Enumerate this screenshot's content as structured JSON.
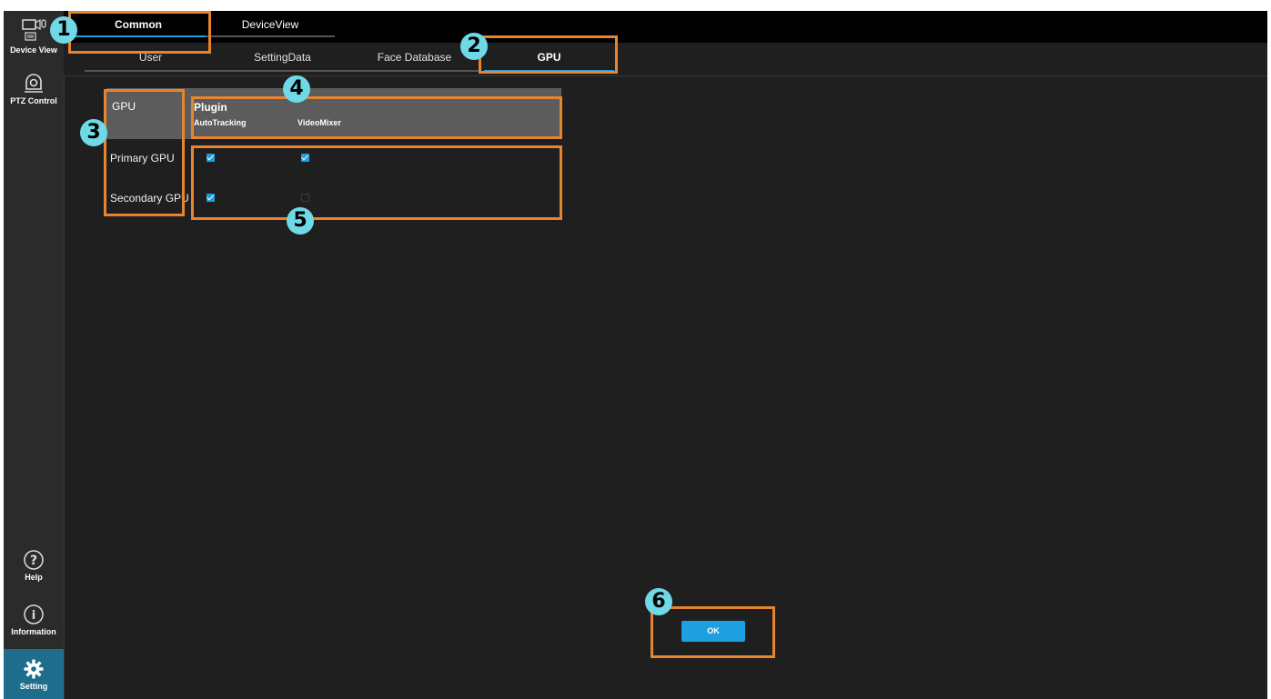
{
  "sidebar": {
    "items": [
      {
        "label": "Device View",
        "icon": "camera-mic-icon"
      },
      {
        "label": "PTZ Control",
        "icon": "ptz-camera-icon"
      },
      {
        "label": "Help",
        "icon": "help-icon"
      },
      {
        "label": "Information",
        "icon": "info-icon"
      },
      {
        "label": "Setting",
        "icon": "gear-icon",
        "active": true
      }
    ]
  },
  "tabs": {
    "main": [
      {
        "label": "Common",
        "active": true
      },
      {
        "label": "DeviceView",
        "active": false
      }
    ],
    "sub": [
      {
        "label": "User",
        "active": false
      },
      {
        "label": "SettingData",
        "active": false
      },
      {
        "label": "Face Database",
        "active": false
      },
      {
        "label": "GPU",
        "active": true
      }
    ]
  },
  "gpu_table": {
    "header_label": "GPU",
    "plugin_title": "Plugin",
    "plugins": [
      "AutoTracking",
      "VideoMixer"
    ],
    "rows": [
      {
        "label": "Primary GPU",
        "values": [
          true,
          true
        ]
      },
      {
        "label": "Secondary GPU",
        "values": [
          true,
          false
        ]
      }
    ]
  },
  "ok_label": "OK",
  "annotations": [
    "1",
    "2",
    "3",
    "4",
    "5",
    "6"
  ],
  "colors": {
    "accent": "#1ea0e0",
    "annotation_box": "#e7852f",
    "annotation_circle": "#6fd9e6"
  }
}
